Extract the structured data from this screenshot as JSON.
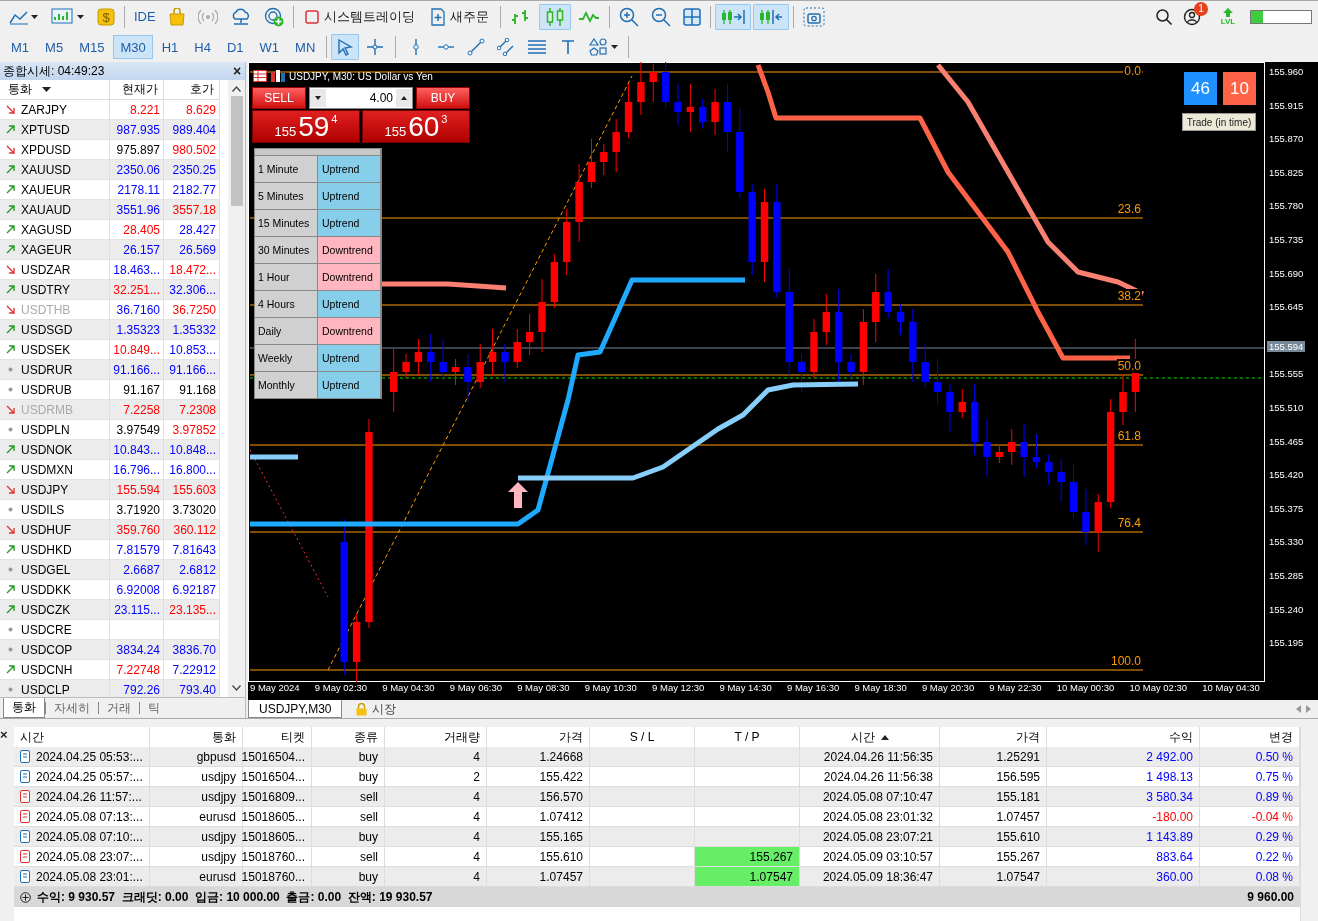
{
  "toolbar": {
    "dollar_sign": "$",
    "ide_label": "IDE",
    "algo_trading_label": "시스템트레이딩",
    "new_order_label": "새주문",
    "chart_types": [
      {
        "selected": false
      },
      {
        "selected": true
      },
      {
        "selected": false
      }
    ],
    "auto_scroll": true,
    "chart_shift": true,
    "notification_count": "1",
    "level_label": "LVL",
    "level": 0.2
  },
  "timeframes": [
    {
      "label": "M1",
      "selected": false
    },
    {
      "label": "M5",
      "selected": false
    },
    {
      "label": "M15",
      "selected": false
    },
    {
      "label": "M30",
      "selected": true
    },
    {
      "label": "H1",
      "selected": false
    },
    {
      "label": "H4",
      "selected": false
    },
    {
      "label": "D1",
      "selected": false
    },
    {
      "label": "W1",
      "selected": false
    },
    {
      "label": "MN",
      "selected": false
    }
  ],
  "tools": [
    {
      "selected": true
    },
    {
      "selected": false
    },
    {
      "selected": false
    },
    {
      "selected": false
    },
    {
      "selected": false
    },
    {
      "selected": false
    },
    {
      "selected": false
    },
    {
      "selected": false
    },
    {
      "selected": false
    }
  ],
  "market_watch": {
    "title": "종합시세: 04:49:23",
    "close": "×",
    "columns": [
      "통화",
      "현재가",
      "호가"
    ],
    "rows": [
      {
        "symbol": "ZARJPY",
        "kind": "down",
        "disabled": false,
        "bid": {
          "text": "8.221",
          "color": "#ff0000"
        },
        "ask": {
          "text": "8.629",
          "color": "#ff0000"
        }
      },
      {
        "symbol": "XPTUSD",
        "kind": "up",
        "disabled": false,
        "bid": {
          "text": "987.935",
          "color": "#0000ff"
        },
        "ask": {
          "text": "989.404",
          "color": "#0000ff"
        }
      },
      {
        "symbol": "XPDUSD",
        "kind": "down",
        "disabled": false,
        "bid": {
          "text": "975.897",
          "color": "#000000"
        },
        "ask": {
          "text": "980.502",
          "color": "#ff0000"
        }
      },
      {
        "symbol": "XAUUSD",
        "kind": "up",
        "disabled": false,
        "bid": {
          "text": "2350.06",
          "color": "#0000ff"
        },
        "ask": {
          "text": "2350.25",
          "color": "#0000ff"
        }
      },
      {
        "symbol": "XAUEUR",
        "kind": "up",
        "disabled": false,
        "bid": {
          "text": "2178.11",
          "color": "#0000ff"
        },
        "ask": {
          "text": "2182.77",
          "color": "#0000ff"
        }
      },
      {
        "symbol": "XAUAUD",
        "kind": "up",
        "disabled": false,
        "bid": {
          "text": "3551.96",
          "color": "#0000ff"
        },
        "ask": {
          "text": "3557.18",
          "color": "#ff0000"
        }
      },
      {
        "symbol": "XAGUSD",
        "kind": "up",
        "disabled": false,
        "bid": {
          "text": "28.405",
          "color": "#ff0000"
        },
        "ask": {
          "text": "28.427",
          "color": "#0000ff"
        }
      },
      {
        "symbol": "XAGEUR",
        "kind": "up",
        "disabled": false,
        "bid": {
          "text": "26.157",
          "color": "#0000ff"
        },
        "ask": {
          "text": "26.569",
          "color": "#0000ff"
        }
      },
      {
        "symbol": "USDZAR",
        "kind": "down",
        "disabled": false,
        "bid": {
          "text": "18.463...",
          "color": "#0000ff"
        },
        "ask": {
          "text": "18.472...",
          "color": "#ff0000"
        }
      },
      {
        "symbol": "USDTRY",
        "kind": "up",
        "disabled": false,
        "bid": {
          "text": "32.251...",
          "color": "#ff0000"
        },
        "ask": {
          "text": "32.306...",
          "color": "#0000ff"
        }
      },
      {
        "symbol": "USDTHB",
        "kind": "down",
        "disabled": true,
        "bid": {
          "text": "36.7160",
          "color": "#0000ff"
        },
        "ask": {
          "text": "36.7250",
          "color": "#ff0000"
        }
      },
      {
        "symbol": "USDSGD",
        "kind": "up",
        "disabled": false,
        "bid": {
          "text": "1.35323",
          "color": "#0000ff"
        },
        "ask": {
          "text": "1.35332",
          "color": "#0000ff"
        }
      },
      {
        "symbol": "USDSEK",
        "kind": "up",
        "disabled": false,
        "bid": {
          "text": "10.849...",
          "color": "#ff0000"
        },
        "ask": {
          "text": "10.853...",
          "color": "#0000ff"
        }
      },
      {
        "symbol": "USDRUR",
        "kind": "flat",
        "disabled": false,
        "bid": {
          "text": "91.166...",
          "color": "#0000ff"
        },
        "ask": {
          "text": "91.166...",
          "color": "#0000ff"
        }
      },
      {
        "symbol": "USDRUB",
        "kind": "flat",
        "disabled": false,
        "bid": {
          "text": "91.167",
          "color": "#000000"
        },
        "ask": {
          "text": "91.168",
          "color": "#000000"
        }
      },
      {
        "symbol": "USDRMB",
        "kind": "down",
        "disabled": true,
        "bid": {
          "text": "7.2258",
          "color": "#ff0000"
        },
        "ask": {
          "text": "7.2308",
          "color": "#ff0000"
        }
      },
      {
        "symbol": "USDPLN",
        "kind": "flat",
        "disabled": false,
        "bid": {
          "text": "3.97549",
          "color": "#000000"
        },
        "ask": {
          "text": "3.97852",
          "color": "#ff0000"
        }
      },
      {
        "symbol": "USDNOK",
        "kind": "up",
        "disabled": false,
        "bid": {
          "text": "10.843...",
          "color": "#0000ff"
        },
        "ask": {
          "text": "10.848...",
          "color": "#0000ff"
        }
      },
      {
        "symbol": "USDMXN",
        "kind": "up",
        "disabled": false,
        "bid": {
          "text": "16.796...",
          "color": "#0000ff"
        },
        "ask": {
          "text": "16.800...",
          "color": "#0000ff"
        }
      },
      {
        "symbol": "USDJPY",
        "kind": "down",
        "disabled": false,
        "bid": {
          "text": "155.594",
          "color": "#ff0000"
        },
        "ask": {
          "text": "155.603",
          "color": "#ff0000"
        }
      },
      {
        "symbol": "USDILS",
        "kind": "flat",
        "disabled": false,
        "bid": {
          "text": "3.71920",
          "color": "#000000"
        },
        "ask": {
          "text": "3.73020",
          "color": "#000000"
        }
      },
      {
        "symbol": "USDHUF",
        "kind": "down",
        "disabled": false,
        "bid": {
          "text": "359.760",
          "color": "#ff0000"
        },
        "ask": {
          "text": "360.112",
          "color": "#ff0000"
        }
      },
      {
        "symbol": "USDHKD",
        "kind": "up",
        "disabled": false,
        "bid": {
          "text": "7.81579",
          "color": "#0000ff"
        },
        "ask": {
          "text": "7.81643",
          "color": "#0000ff"
        }
      },
      {
        "symbol": "USDGEL",
        "kind": "flat",
        "disabled": false,
        "bid": {
          "text": "2.6687",
          "color": "#0000ff"
        },
        "ask": {
          "text": "2.6812",
          "color": "#0000ff"
        }
      },
      {
        "symbol": "USDDKK",
        "kind": "up",
        "disabled": false,
        "bid": {
          "text": "6.92008",
          "color": "#0000ff"
        },
        "ask": {
          "text": "6.92187",
          "color": "#0000ff"
        }
      },
      {
        "symbol": "USDCZK",
        "kind": "up",
        "disabled": false,
        "bid": {
          "text": "23.115...",
          "color": "#0000ff"
        },
        "ask": {
          "text": "23.135...",
          "color": "#ff0000"
        }
      },
      {
        "symbol": "USDCRE",
        "kind": "flat",
        "disabled": false
      },
      {
        "symbol": "USDCOP",
        "kind": "flat",
        "disabled": false,
        "bid": {
          "text": "3834.24",
          "color": "#0000ff"
        },
        "ask": {
          "text": "3836.70",
          "color": "#0000ff"
        }
      },
      {
        "symbol": "USDCNH",
        "kind": "up",
        "disabled": false,
        "bid": {
          "text": "7.22748",
          "color": "#ff0000"
        },
        "ask": {
          "text": "7.22912",
          "color": "#0000ff"
        }
      },
      {
        "symbol": "USDCLP",
        "kind": "flat",
        "disabled": false,
        "bid": {
          "text": "792.26",
          "color": "#0000ff"
        },
        "ask": {
          "text": "793.40",
          "color": "#0000ff"
        }
      }
    ],
    "tabs": [
      {
        "label": "통화",
        "selected": true
      },
      {
        "label": "자세히",
        "selected": false
      },
      {
        "label": "거래",
        "selected": false
      },
      {
        "label": "틱",
        "selected": false
      }
    ]
  },
  "chart": {
    "title": "USDJPY, M30:  US Dollar vs Yen",
    "trade_panel": {
      "sell_label": "SELL",
      "buy_label": "BUY",
      "volume": "4.00",
      "sell_price": {
        "big_figure": "155",
        "pips": "59",
        "point": "4"
      },
      "buy_price": {
        "big_figure": "155",
        "pips": "60",
        "point": "3"
      }
    },
    "trends": [
      {
        "period": "1 Minute",
        "kind": "up",
        "label": "Uptrend"
      },
      {
        "period": "5 Minutes",
        "kind": "up",
        "label": "Uptrend"
      },
      {
        "period": "15 Minutes",
        "kind": "up",
        "label": "Uptrend"
      },
      {
        "period": "30 Minutes",
        "kind": "down",
        "label": "Downtrend"
      },
      {
        "period": "1 Hour",
        "kind": "down",
        "label": "Downtrend"
      },
      {
        "period": "4 Hours",
        "kind": "up",
        "label": "Uptrend"
      },
      {
        "period": "Daily",
        "kind": "down",
        "label": "Downtrend"
      },
      {
        "period": "Weekly",
        "kind": "up",
        "label": "Uptrend"
      },
      {
        "period": "Monthly",
        "kind": "up",
        "label": "Uptrend"
      }
    ],
    "counters": [
      {
        "value": "46",
        "color": "#1e90ff"
      },
      {
        "value": "10",
        "color": "#ff6347"
      }
    ],
    "trade_button": "Trade (in time)",
    "fib_levels": [
      "0.0",
      "23.6",
      "38.2",
      "50.0",
      "61.8",
      "76.4",
      "100.0"
    ],
    "price_ticks": [
      "155.960",
      "155.915",
      "155.870",
      "155.825",
      "155.780",
      "155.735",
      "155.690",
      "155.645",
      "155.555",
      "155.510",
      "155.465",
      "155.420",
      "155.375",
      "155.330",
      "155.285",
      "155.240",
      "155.195"
    ],
    "current_price": "155.594",
    "time_ticks": [
      "9 May 2024",
      "9 May 02:30",
      "9 May 04:30",
      "9 May 06:30",
      "9 May 08:30",
      "9 May 10:30",
      "9 May 12:30",
      "9 May 14:30",
      "9 May 16:30",
      "9 May 18:30",
      "9 May 20:30",
      "9 May 22:30",
      "10 May 00:30",
      "10 May 02:30",
      "10 May 04:30"
    ],
    "tabs": [
      {
        "label": "USDJPY,M30",
        "selected": true
      },
      {
        "label": "시장",
        "selected": false
      }
    ]
  },
  "trades": {
    "close": "×",
    "columns": [
      {
        "label": "시간",
        "sorted": false
      },
      {
        "label": "통화",
        "sorted": false
      },
      {
        "label": "티켓",
        "sorted": false
      },
      {
        "label": "종류",
        "sorted": false
      },
      {
        "label": "거래량",
        "sorted": false
      },
      {
        "label": "가격",
        "sorted": false
      },
      {
        "label": "S / L",
        "sorted": false
      },
      {
        "label": "T / P",
        "sorted": false
      },
      {
        "label": "시간",
        "sorted": true
      },
      {
        "label": "가격",
        "sorted": false
      },
      {
        "label": "수익",
        "sorted": false
      },
      {
        "label": "변경",
        "sorted": false
      }
    ],
    "rows": [
      {
        "kind": "buy",
        "open_time": "2024.04.25 05:53:...",
        "symbol": "gbpusd",
        "ticket": "15016504...",
        "type": "buy",
        "volume": "4",
        "open_price": "1.24668",
        "tp_hit": false,
        "close_time": "2024.04.26 11:56:35",
        "close_price": "1.25291",
        "profit": {
          "text": "2 492.00",
          "color": "#0000ff"
        },
        "change": {
          "text": "0.50 %",
          "color": "#0000ff"
        }
      },
      {
        "kind": "buy",
        "open_time": "2024.04.25 05:57:...",
        "symbol": "usdjpy",
        "ticket": "15016504...",
        "type": "buy",
        "volume": "2",
        "open_price": "155.422",
        "tp_hit": false,
        "close_time": "2024.04.26 11:56:38",
        "close_price": "156.595",
        "profit": {
          "text": "1 498.13",
          "color": "#0000ff"
        },
        "change": {
          "text": "0.75 %",
          "color": "#0000ff"
        }
      },
      {
        "kind": "sell",
        "open_time": "2024.04.26 11:57:...",
        "symbol": "usdjpy",
        "ticket": "15016809...",
        "type": "sell",
        "volume": "4",
        "open_price": "156.570",
        "tp_hit": false,
        "close_time": "2024.05.08 07:10:47",
        "close_price": "155.181",
        "profit": {
          "text": "3 580.34",
          "color": "#0000ff"
        },
        "change": {
          "text": "0.89 %",
          "color": "#0000ff"
        }
      },
      {
        "kind": "sell",
        "open_time": "2024.05.08 07:13:...",
        "symbol": "eurusd",
        "ticket": "15018605...",
        "type": "sell",
        "volume": "4",
        "open_price": "1.07412",
        "tp_hit": false,
        "close_time": "2024.05.08 23:01:32",
        "close_price": "1.07457",
        "profit": {
          "text": "-180.00",
          "color": "#ff0000"
        },
        "change": {
          "text": "-0.04 %",
          "color": "#ff0000"
        }
      },
      {
        "kind": "buy",
        "open_time": "2024.05.08 07:10:...",
        "symbol": "usdjpy",
        "ticket": "15018605...",
        "type": "buy",
        "volume": "4",
        "open_price": "155.165",
        "tp_hit": false,
        "close_time": "2024.05.08 23:07:21",
        "close_price": "155.610",
        "profit": {
          "text": "1 143.89",
          "color": "#0000ff"
        },
        "change": {
          "text": "0.29 %",
          "color": "#0000ff"
        }
      },
      {
        "kind": "sell",
        "open_time": "2024.05.08 23:07:...",
        "symbol": "usdjpy",
        "ticket": "15018760...",
        "type": "sell",
        "volume": "4",
        "open_price": "155.610",
        "tp": "155.267",
        "tp_hit": true,
        "close_time": "2024.05.09 03:10:57",
        "close_price": "155.267",
        "profit": {
          "text": "883.64",
          "color": "#0000ff"
        },
        "change": {
          "text": "0.22 %",
          "color": "#0000ff"
        }
      },
      {
        "kind": "buy",
        "open_time": "2024.05.08 23:01:...",
        "symbol": "eurusd",
        "ticket": "15018760...",
        "type": "buy",
        "volume": "4",
        "open_price": "1.07457",
        "tp": "1.07547",
        "tp_hit": true,
        "close_time": "2024.05.09 18:36:47",
        "close_price": "1.07547",
        "profit": {
          "text": "360.00",
          "color": "#0000ff"
        },
        "change": {
          "text": "0.08 %",
          "color": "#0000ff"
        }
      }
    ],
    "summary": "수익: 9 930.57  크래딧: 0.00  입금: 10 000.00  출금: 0.00  잔액: 19 930.57",
    "total": "9 960.00"
  }
}
